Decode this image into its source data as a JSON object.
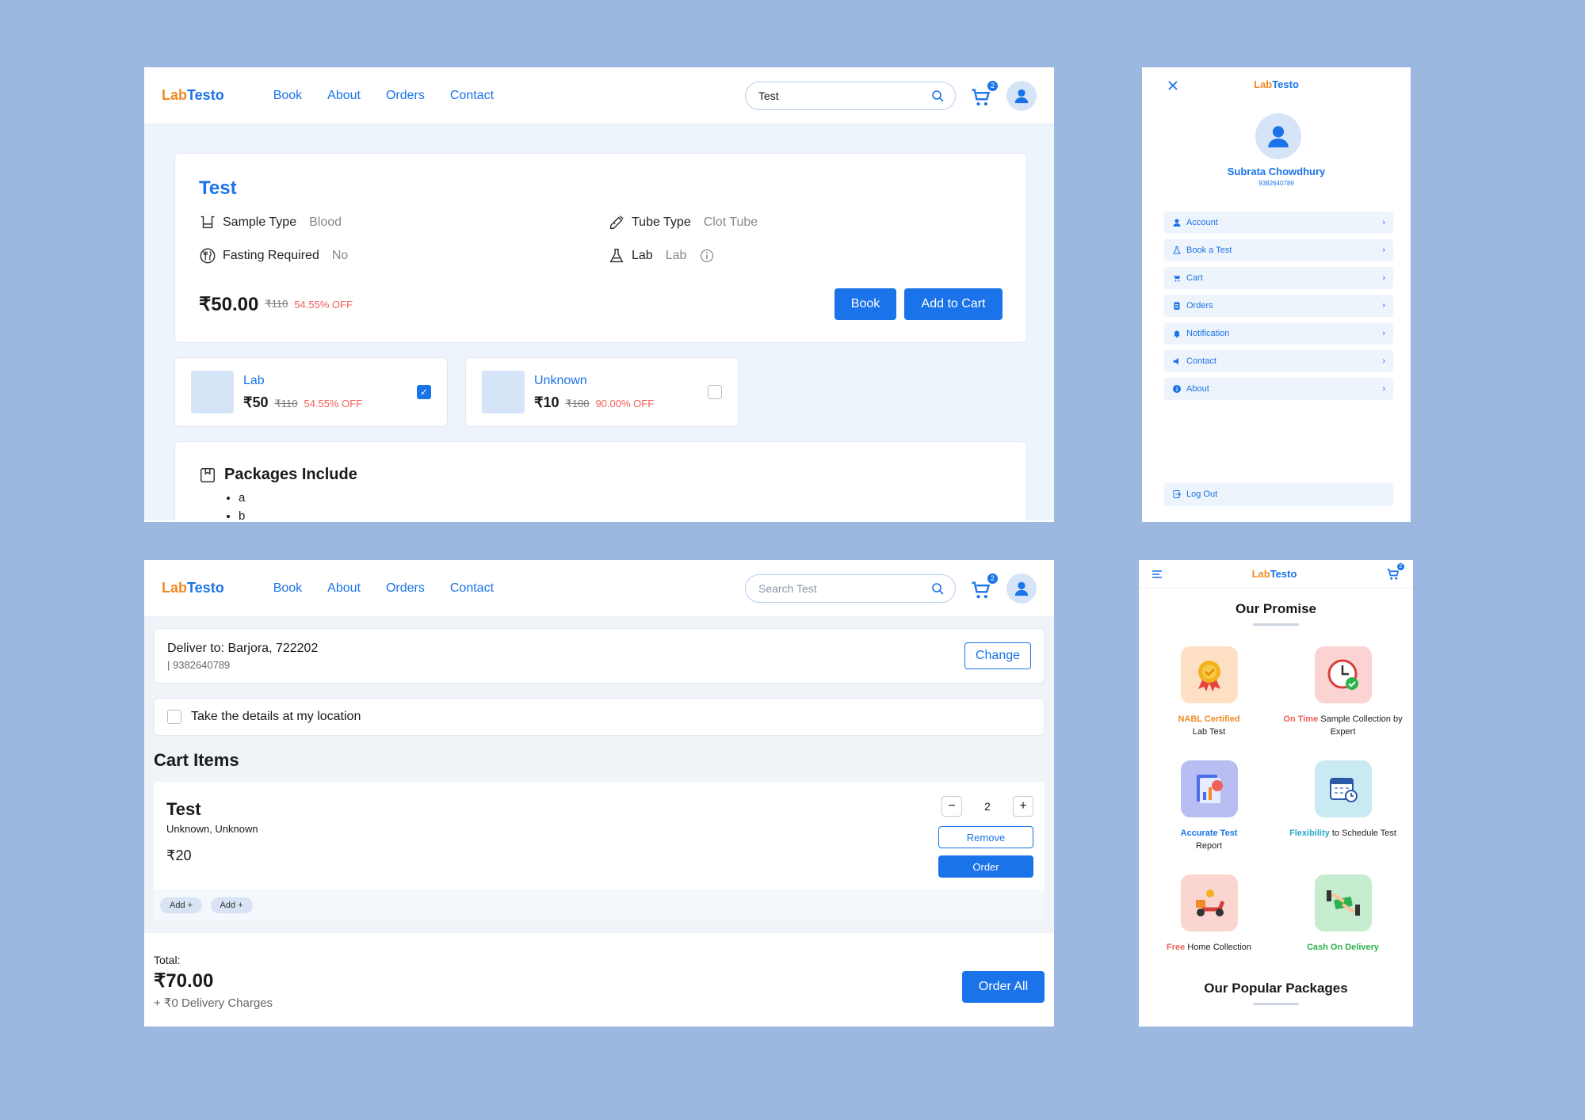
{
  "colors": {
    "background": "#9db8e0",
    "primary": "#1a73e8",
    "accent_orange": "#f08a24",
    "discount_red": "#f0605a",
    "green": "#2bb24c"
  },
  "brand": {
    "part1": "Lab",
    "part2": "Testo"
  },
  "nav": {
    "links": [
      "Book",
      "About",
      "Orders",
      "Contact"
    ],
    "cart_count": "2"
  },
  "test_page": {
    "search_value": "Test",
    "title": "Test",
    "attributes": [
      {
        "label": "Sample Type",
        "value": "Blood",
        "icon": "beaker-icon"
      },
      {
        "label": "Tube Type",
        "value": "Clot Tube",
        "icon": "syringe-icon"
      },
      {
        "label": "Fasting Required",
        "value": "No",
        "icon": "fasting-icon"
      },
      {
        "label": "Lab",
        "value": "Lab",
        "icon": "flask-icon"
      }
    ],
    "price": "₹50.00",
    "original_price": "₹110",
    "discount": "54.55% OFF",
    "book_label": "Book",
    "add_to_cart_label": "Add to Cart",
    "labs": [
      {
        "name": "Lab",
        "price": "₹50",
        "original": "₹110",
        "discount": "54.55% OFF",
        "selected": true
      },
      {
        "name": "Unknown",
        "price": "₹10",
        "original": "₹100",
        "discount": "90.00% OFF",
        "selected": false
      }
    ],
    "packages_title": "Packages Include",
    "packages": [
      "a",
      "b"
    ]
  },
  "side_menu": {
    "user_name": "Subrata Chowdhury",
    "phone": "9382640789",
    "items": [
      {
        "label": "Account",
        "icon": "user-icon"
      },
      {
        "label": "Book a Test",
        "icon": "flask-icon"
      },
      {
        "label": "Cart",
        "icon": "cart-icon"
      },
      {
        "label": "Orders",
        "icon": "clipboard-icon"
      },
      {
        "label": "Notification",
        "icon": "bell-icon"
      },
      {
        "label": "Contact",
        "icon": "megaphone-icon"
      },
      {
        "label": "About",
        "icon": "info-icon"
      }
    ],
    "logout": "Log Out"
  },
  "cart_page": {
    "search_placeholder": "Search Test",
    "deliver_label": "Deliver to:",
    "deliver_address": "Barjora, 722202",
    "deliver_phone": "| 9382640789",
    "change_label": "Change",
    "location_label": "Take the details at my location",
    "cart_items_title": "Cart Items",
    "item": {
      "name": "Test",
      "labs": "Unknown, Unknown",
      "price": "₹20",
      "quantity": "2",
      "remove_label": "Remove",
      "order_label": "Order",
      "addons": [
        "Add +",
        "Add +"
      ]
    },
    "total_label": "Total:",
    "total_value": "₹70.00",
    "delivery_charges": "+ ₹0 Delivery Charges",
    "order_all_label": "Order All"
  },
  "promise": {
    "title": "Our Promise",
    "items": [
      {
        "highlight": "NABL Certified",
        "rest": "Lab Test",
        "highlight_color": "#f08a24",
        "icon": "award-icon"
      },
      {
        "highlight": "On Time",
        "rest": "Sample Collection by Expert",
        "highlight_color": "#f0605a",
        "icon": "clock-icon"
      },
      {
        "highlight": "Accurate Test",
        "rest": "Report",
        "highlight_color": "#1a73e8",
        "icon": "report-icon"
      },
      {
        "highlight": "Flexibility",
        "rest": "to Schedule Test",
        "highlight_color": "#2aa7c9",
        "icon": "calendar-icon"
      },
      {
        "highlight": "Free",
        "rest": "Home Collection",
        "highlight_color": "#f0605a",
        "icon": "scooter-icon"
      },
      {
        "highlight": "Cash On Delivery",
        "rest": "",
        "highlight_color": "#2bb24c",
        "icon": "cash-icon"
      }
    ],
    "packages_title": "Our Popular Packages",
    "cart_count": "2"
  }
}
